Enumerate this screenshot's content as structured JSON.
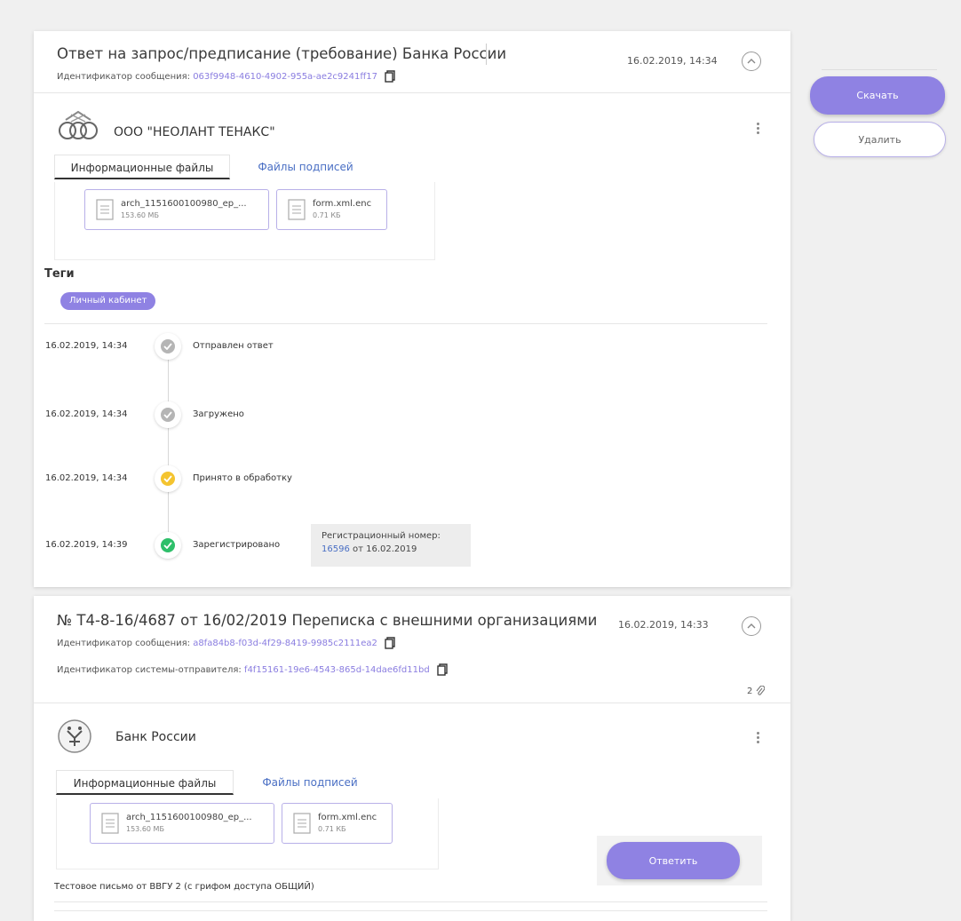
{
  "colors": {
    "accent": "#8f82e3",
    "link": "#4a6fc4",
    "status_done": "#2ebf6a",
    "status_processing": "#f4c430",
    "status_gray": "#b5b5b5"
  },
  "actions": {
    "download_label": "Скачать",
    "delete_label": "Удалить",
    "reply_label": "Ответить"
  },
  "messages": [
    {
      "title": "Ответ на запрос/предписание (требование) Банка России",
      "date": "16.02.2019, 14:34",
      "message_id_label": "Идентификатор сообщения:",
      "message_id": "063f9948-4610-4902-955a-ae2c9241ff17",
      "org_name": "ООО \"НЕОЛАНТ ТЕНАКС\"",
      "tabs": [
        "Информационные файлы",
        "Файлы подписей"
      ],
      "files": [
        {
          "name": "arch_1151600100980_ep_...",
          "size": "153.60 МБ",
          "icon": "document-icon"
        },
        {
          "name": "form.xml.enc",
          "size": "0.71 КБ",
          "icon": "document-icon"
        }
      ],
      "tags_label": "Теги",
      "tags": [
        "Личный кабинет"
      ],
      "timeline": [
        {
          "date": "16.02.2019, 14:34",
          "label": "Отправлен ответ",
          "status": "gray"
        },
        {
          "date": "16.02.2019, 14:34",
          "label": "Загружено",
          "status": "gray"
        },
        {
          "date": "16.02.2019, 14:34",
          "label": "Принято в обработку",
          "status": "processing"
        },
        {
          "date": "16.02.2019, 14:39",
          "label": "Зарегистрировано",
          "status": "done"
        }
      ],
      "registration": {
        "label": "Регистрационный номер:",
        "number": "16596",
        "date_text": "от 16.02.2019"
      }
    },
    {
      "title": "№ Т4-8-16/4687 от 16/02/2019 Переписка с внешними организациями",
      "date": "16.02.2019, 14:33",
      "message_id_label": "Идентификатор сообщения:",
      "message_id": "a8fa84b8-f03d-4f29-8419-9985c2111ea2",
      "sender_system_id_label": "Идентификатор системы-отправителя:",
      "sender_system_id": "f4f15161-19e6-4543-865d-14dae6fd11bd",
      "attachments_count": "2",
      "org_name": "Банк России",
      "tabs": [
        "Информационные файлы",
        "Файлы подписей"
      ],
      "files": [
        {
          "name": "arch_1151600100980_ep_...",
          "size": "153.60 МБ",
          "icon": "document-icon"
        },
        {
          "name": "form.xml.enc",
          "size": "0.71 КБ",
          "icon": "document-icon"
        }
      ],
      "body_text": "Тестовое письмо от ВВГУ 2 (с грифом доступа ОБЩИЙ)"
    }
  ]
}
